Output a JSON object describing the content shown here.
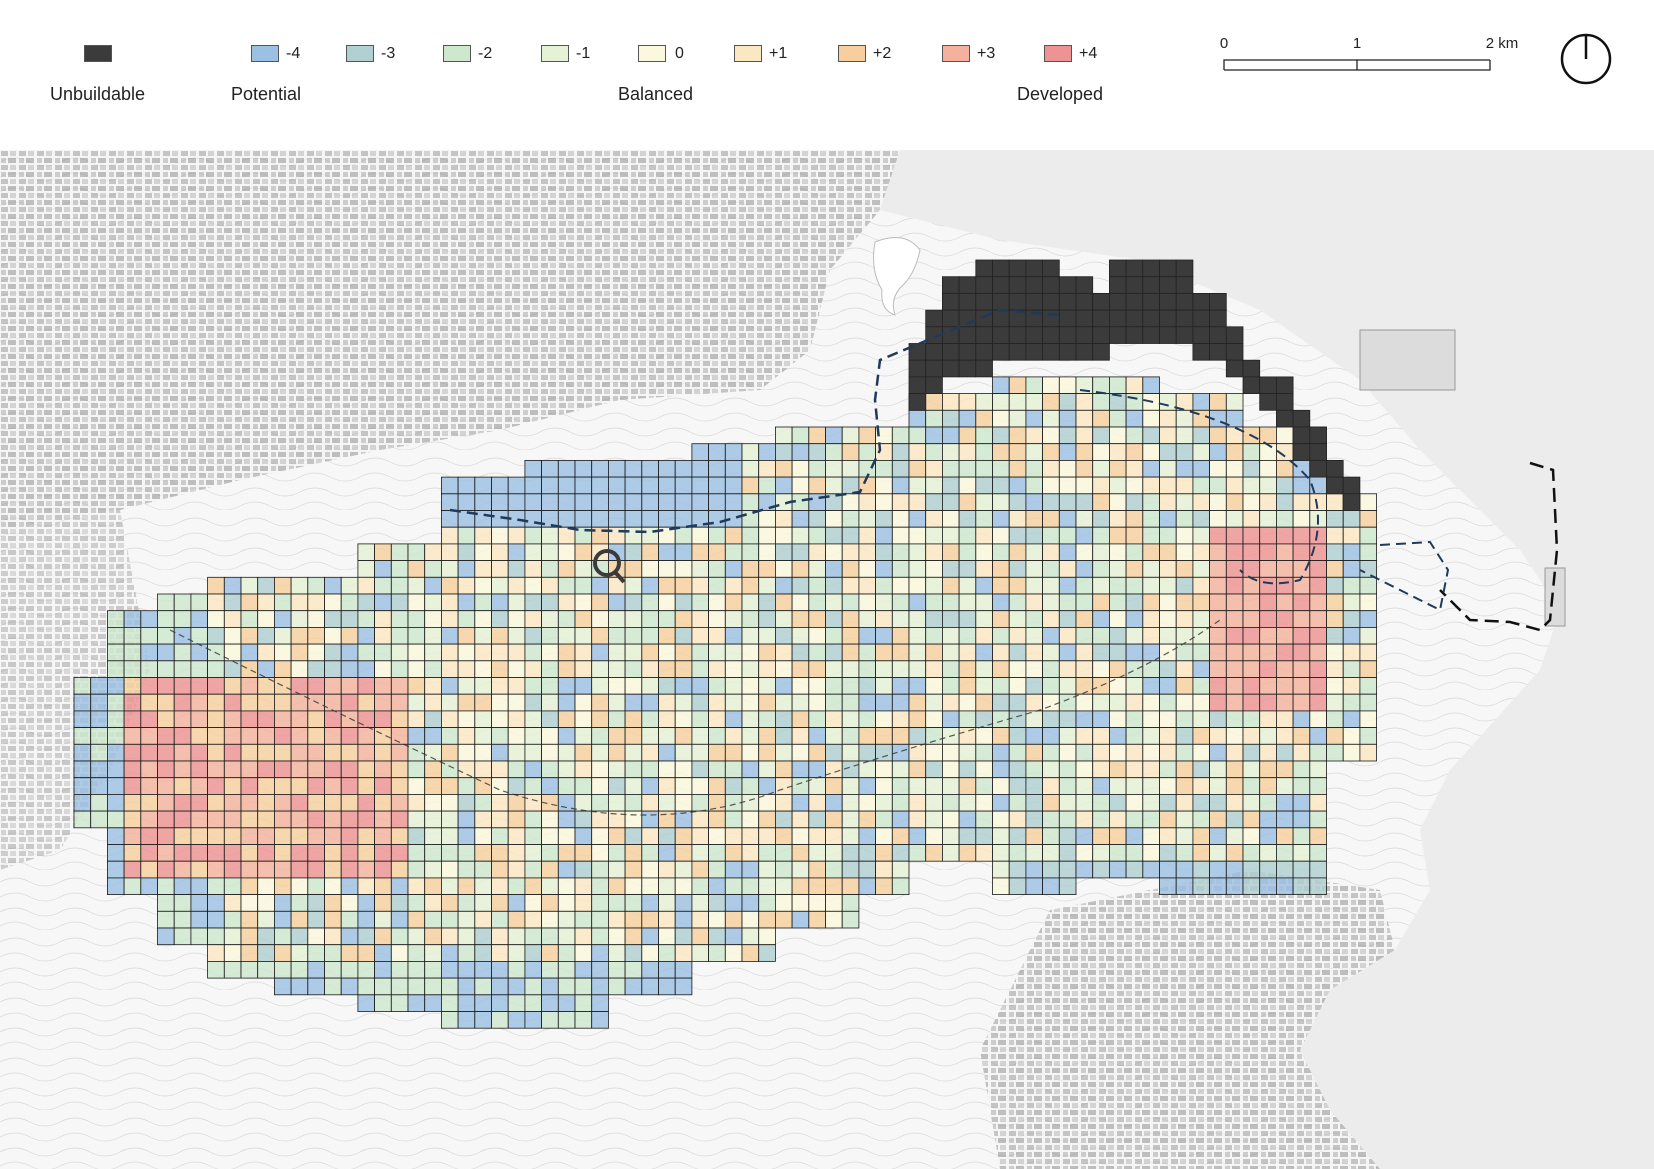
{
  "legend": {
    "unbuildable": {
      "label": "Unbuildable",
      "color": "#3b3b3b"
    },
    "classes": [
      {
        "value": "-4",
        "color": "#9cc0e2"
      },
      {
        "value": "-3",
        "color": "#b0d0d2"
      },
      {
        "value": "-2",
        "color": "#cde8cd"
      },
      {
        "value": "-1",
        "color": "#e5f2d6"
      },
      {
        "value": "0",
        "color": "#fbf8dd"
      },
      {
        "value": "+1",
        "color": "#fbe8c2"
      },
      {
        "value": "+2",
        "color": "#f7cf9e"
      },
      {
        "value": "+3",
        "color": "#f4b29e"
      },
      {
        "value": "+4",
        "color": "#ee9393"
      }
    ],
    "group_labels": {
      "potential": "Potential",
      "balanced": "Balanced",
      "developed": "Developed"
    }
  },
  "scale_bar": {
    "ticks": [
      "0",
      "1",
      "2 km"
    ]
  },
  "north_arrow": {
    "icon": "north-arrow-icon"
  },
  "map": {
    "background_color": "#f2f2f2",
    "water_color": "#efefef",
    "grid_line_color": "#1a1a1a",
    "boundary_line": "dashed"
  }
}
